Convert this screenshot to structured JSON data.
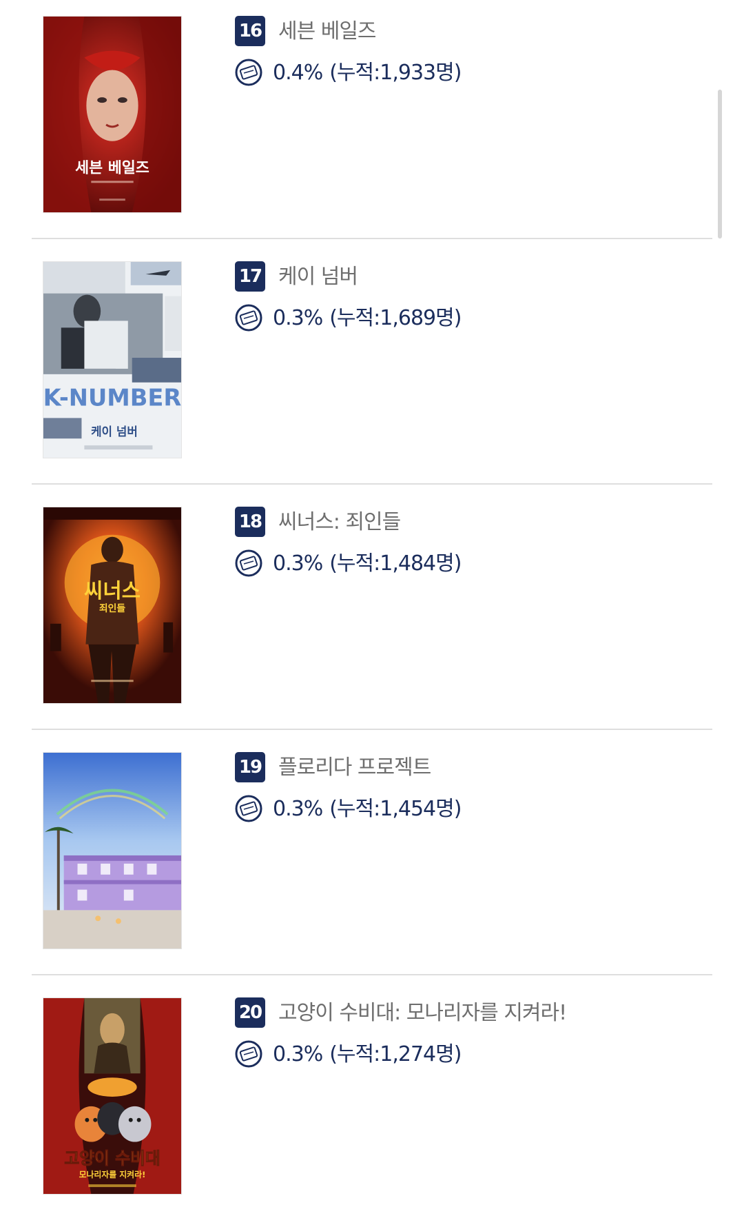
{
  "movies": [
    {
      "rank": "16",
      "title": "세븐 베일즈",
      "share": "0.4%",
      "cumulative": "(누적:1,933명)",
      "poster": {
        "title_text": "세븐 베일즈",
        "theme": "red-veil-portrait"
      }
    },
    {
      "rank": "17",
      "title": "케이 넘버",
      "share": "0.3%",
      "cumulative": "(누적:1,689명)",
      "poster": {
        "title_text": "K-NUMBER",
        "subtitle_text": "케이 넘버",
        "theme": "collage-light"
      }
    },
    {
      "rank": "18",
      "title": "씨너스: 죄인들",
      "share": "0.3%",
      "cumulative": "(누적:1,484명)",
      "poster": {
        "title_text": "씨너스",
        "subtitle_text": "죄인들",
        "theme": "orange-sunset-figure"
      }
    },
    {
      "rank": "19",
      "title": "플로리다 프로젝트",
      "share": "0.3%",
      "cumulative": "(누적:1,454명)",
      "poster": {
        "theme": "purple-motel-sky"
      }
    },
    {
      "rank": "20",
      "title": "고양이 수비대: 모나리자를 지켜라!",
      "share": "0.3%",
      "cumulative": "(누적:1,274명)",
      "poster": {
        "title_text": "고양이 수비대",
        "subtitle_text": "모나리자를 지켜라!",
        "theme": "stage-curtains-cats"
      }
    }
  ],
  "icons": {
    "share": "ticket-icon"
  },
  "colors": {
    "badge": "#1b2d5c",
    "title": "#6e6e6e",
    "share_text": "#1b2d5c",
    "divider": "#dedede"
  }
}
